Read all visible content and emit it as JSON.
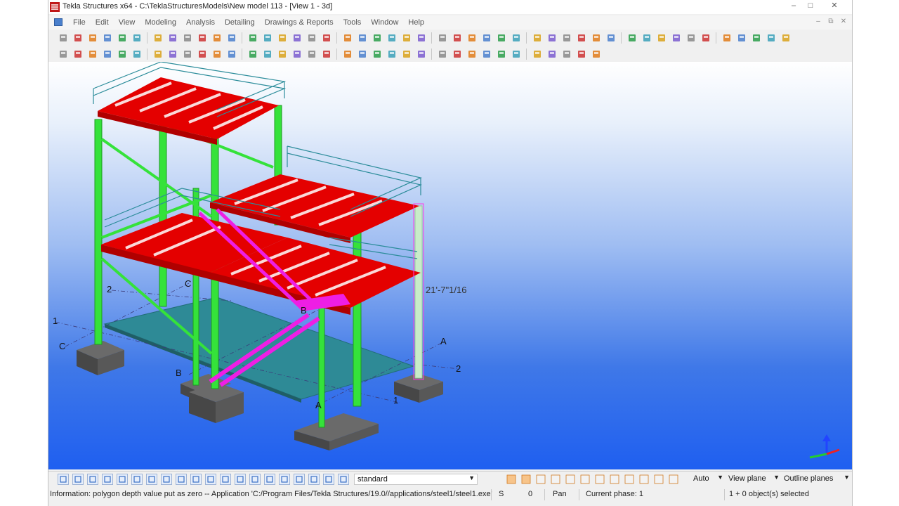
{
  "window": {
    "title": "Tekla Structures x64 - C:\\TeklaStructuresModels\\New model 113  - [View 1 - 3d]",
    "app_icon": "tekla-logo-icon",
    "controls": [
      "minimize-icon",
      "restore-icon",
      "close-icon"
    ]
  },
  "menubar": {
    "items": [
      "File",
      "Edit",
      "View",
      "Modeling",
      "Analysis",
      "Detailing",
      "Drawings & Reports",
      "Tools",
      "Window",
      "Help"
    ]
  },
  "toolbars": {
    "row1": [
      "new-icon",
      "open-icon",
      "save-icon",
      "undo-icon",
      "redo-icon",
      "copy-icon",
      "paste-icon",
      "clipboard-icon",
      "cut-icon",
      "properties-icon",
      "window-icon",
      "window-alt-icon",
      "select-icon",
      "highlight-icon",
      "layers-icon",
      "report-icon",
      "drawing-icon",
      "list-icon",
      "template-icon",
      "arrow-icon",
      "arrow-alt-icon",
      "model-icon",
      "model-alt-icon",
      "query-icon",
      "grid-icon",
      "grid-alt-icon",
      "angle-icon",
      "point-icon",
      "arc-icon",
      "measure-icon",
      "copy-special-icon",
      "move-icon",
      "rotate-icon",
      "mirror-icon",
      "clash-icon",
      "numbering-icon",
      "tekla-icon",
      "forward-icon",
      "link-icon",
      "load-icon",
      "view-a-icon",
      "view-b-icon",
      "view-c-icon",
      "view-d-icon",
      "wrench-icon",
      "settings-icon",
      "export-icon"
    ],
    "row2": [
      "beam-icon",
      "column-icon",
      "pad-icon",
      "plate-icon",
      "line-icon",
      "line-alt-icon",
      "bend-icon",
      "cut-line-icon",
      "polygon-cut-icon",
      "weld-icon",
      "fitting-icon",
      "split-icon",
      "combine-icon",
      "bolt-icon",
      "bolt-alt-icon",
      "assembly-icon",
      "detail-icon",
      "component-icon",
      "hook-icon",
      "hook-alt-icon",
      "stair-icon",
      "rebar-icon",
      "mesh-icon",
      "strand-icon",
      "point-line-icon",
      "point-plane-icon",
      "point-arc-icon",
      "point-cross-icon",
      "point-tangent-icon",
      "point-extend-icon",
      "point-circle-icon",
      "point-target-icon",
      "3d-view-icon",
      "3d-view-alt-icon",
      "dim-tool-icon"
    ]
  },
  "model_labels": {
    "dimension": "21'-7\"1/16",
    "grid": [
      {
        "text": "2"
      },
      {
        "text": "C"
      },
      {
        "text": "1"
      },
      {
        "text": "C"
      },
      {
        "text": "B"
      },
      {
        "text": "B"
      },
      {
        "text": "A"
      },
      {
        "text": "2"
      },
      {
        "text": "A"
      },
      {
        "text": "1"
      }
    ]
  },
  "bottombar": {
    "selection_filter": "standard",
    "snap_depth": "Auto",
    "plane": "View plane",
    "planes_display": "Outline planes"
  },
  "statusbar": {
    "message": "Information: polygon depth value put as zero -- Application 'C:/Program Files/Tekla Structures/19.0//applications/steel1/steel1.exe'",
    "s_label": "S",
    "s_value": "0",
    "mode": "Pan",
    "phase": "Current phase: 1",
    "selected": "1 + 0 object(s) selected"
  },
  "colors": {
    "beam_red": "#e40000",
    "column_green": "#35e23a",
    "stair_magenta": "#ee1ee4",
    "railing_teal": "#2b8c9a",
    "slab_teal": "#2f7f8a",
    "footing_gray": "#505050",
    "viewport_top": "#ffffff",
    "viewport_bottom": "#1f5ff0"
  }
}
